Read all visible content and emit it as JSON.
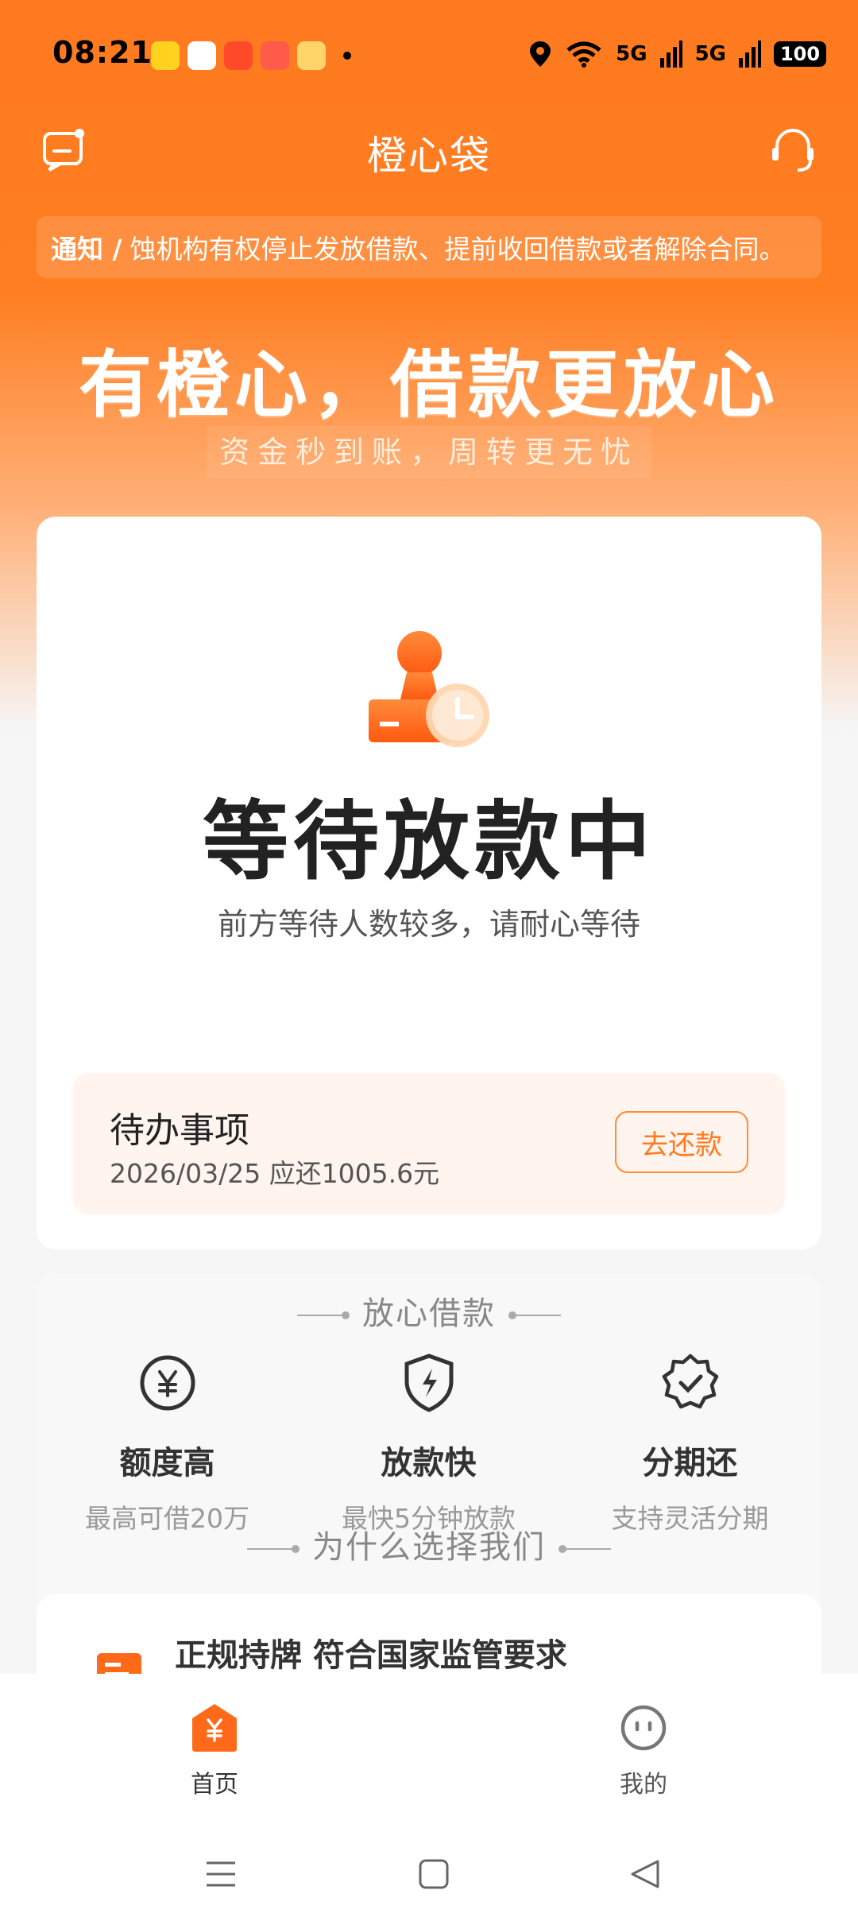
{
  "status_bar": {
    "time": "08:21",
    "battery": "100",
    "signal_1": "5G",
    "signal_2": "5G"
  },
  "header": {
    "title": "橙心袋",
    "message_icon": "message-icon",
    "service_icon": "headset-icon"
  },
  "notice": {
    "label": "通知 /",
    "text": "蚀机构有权停止发放借款、提前收回借款或者解除合同。"
  },
  "banner": {
    "slogan": "有橙心，借款更放心",
    "sub_slogan": "资金秒到账，周转更无忧"
  },
  "loan_status": {
    "title": "等待放款中",
    "description": "前方等待人数较多，请耐心等待"
  },
  "todo": {
    "title": "待办事项",
    "description": "2026/03/25 应还1005.6元",
    "button_label": "去还款"
  },
  "features": {
    "section_title": "放心借款",
    "items": [
      {
        "label": "额度高",
        "sub": "最高可借20万",
        "icon": "yen-circle-icon"
      },
      {
        "label": "放款快",
        "sub": "最快5分钟放款",
        "icon": "lightning-shield-icon"
      },
      {
        "label": "分期还",
        "sub": "支持灵活分期",
        "icon": "check-badge-icon"
      }
    ],
    "why_title": "为什么选择我们"
  },
  "license": {
    "text": "正规持牌 符合国家监管要求"
  },
  "bottom_nav": {
    "home_label": "首页",
    "mine_label": "我的"
  },
  "colors": {
    "accent": "#ff7a1f",
    "todo_bg": "#fff4ee"
  }
}
